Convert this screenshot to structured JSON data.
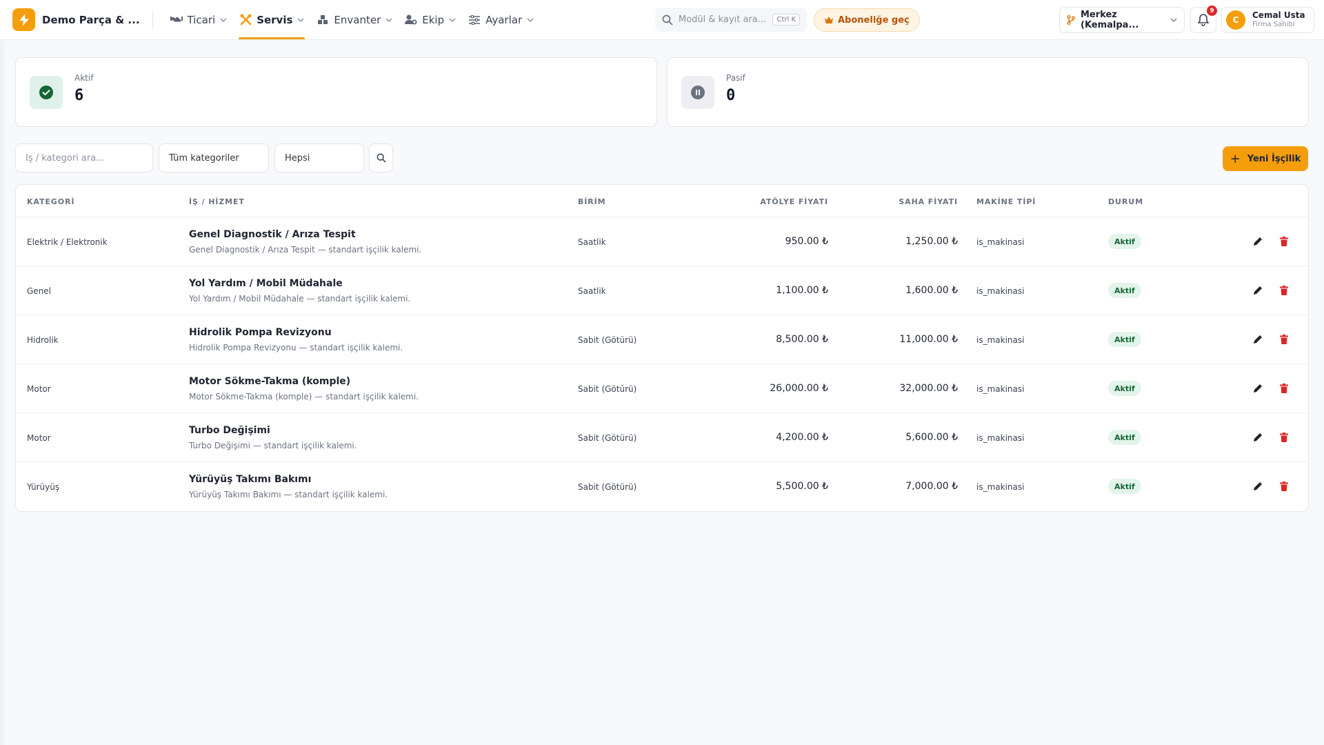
{
  "header": {
    "brand_name": "Demo Parça & ...",
    "nav": [
      {
        "label": "Ticari",
        "icon": "handshake-icon",
        "active": false
      },
      {
        "label": "Servis",
        "icon": "tools-icon",
        "active": true
      },
      {
        "label": "Envanter",
        "icon": "warehouse-icon",
        "active": false
      },
      {
        "label": "Ekip",
        "icon": "user-gear-icon",
        "active": false
      },
      {
        "label": "Ayarlar",
        "icon": "sliders-icon",
        "active": false
      }
    ],
    "search": {
      "placeholder": "Modül & kayıt ara...",
      "shortcut": "Ctrl K"
    },
    "subscribe_label": "Aboneliğe geç",
    "branch_label": "Merkez (Kemalpa...",
    "notification_count": "9",
    "user": {
      "initial": "C",
      "name": "Cemal Usta",
      "role": "Firma Sahibi"
    }
  },
  "stats": {
    "active": {
      "label": "Aktif",
      "value": "6"
    },
    "passive": {
      "label": "Pasif",
      "value": "0"
    }
  },
  "filters": {
    "search_placeholder": "İş / kategori ara...",
    "category_select": "Tüm kategoriler",
    "status_select": "Hepsi"
  },
  "new_button_label": "Yeni İşçilik",
  "table": {
    "columns": {
      "category": "KATEGORİ",
      "job": "İŞ / HİZMET",
      "unit": "BİRİM",
      "workshop_price": "ATÖLYE FİYATI",
      "field_price": "SAHA FİYATI",
      "machine_type": "MAKİNE TİPİ",
      "status": "DURUM"
    },
    "rows": [
      {
        "category": "Elektrik / Elektronik",
        "title": "Genel Diagnostik / Arıza Tespit",
        "desc": "Genel Diagnostik / Arıza Tespit — standart işçilik kalemi.",
        "unit": "Saatlik",
        "workshop_price": "950.00 ₺",
        "field_price": "1,250.00 ₺",
        "machine_type": "is_makinasi",
        "status": "Aktif"
      },
      {
        "category": "Genel",
        "title": "Yol Yardım / Mobil Müdahale",
        "desc": "Yol Yardım / Mobil Müdahale — standart işçilik kalemi.",
        "unit": "Saatlik",
        "workshop_price": "1,100.00 ₺",
        "field_price": "1,600.00 ₺",
        "machine_type": "is_makinasi",
        "status": "Aktif"
      },
      {
        "category": "Hidrolik",
        "title": "Hidrolik Pompa Revizyonu",
        "desc": "Hidrolik Pompa Revizyonu — standart işçilik kalemi.",
        "unit": "Sabit (Götürü)",
        "workshop_price": "8,500.00 ₺",
        "field_price": "11,000.00 ₺",
        "machine_type": "is_makinasi",
        "status": "Aktif"
      },
      {
        "category": "Motor",
        "title": "Motor Sökme-Takma (komple)",
        "desc": "Motor Sökme-Takma (komple) — standart işçilik kalemi.",
        "unit": "Sabit (Götürü)",
        "workshop_price": "26,000.00 ₺",
        "field_price": "32,000.00 ₺",
        "machine_type": "is_makinasi",
        "status": "Aktif"
      },
      {
        "category": "Motor",
        "title": "Turbo Değişimi",
        "desc": "Turbo Değişimi — standart işçilik kalemi.",
        "unit": "Sabit (Götürü)",
        "workshop_price": "4,200.00 ₺",
        "field_price": "5,600.00 ₺",
        "machine_type": "is_makinasi",
        "status": "Aktif"
      },
      {
        "category": "Yürüyüş",
        "title": "Yürüyüş Takımı Bakımı",
        "desc": "Yürüyüş Takımı Bakımı — standart işçilik kalemi.",
        "unit": "Sabit (Götürü)",
        "workshop_price": "5,500.00 ₺",
        "field_price": "7,000.00 ₺",
        "machine_type": "is_makinasi",
        "status": "Aktif"
      }
    ]
  },
  "colors": {
    "accent": "#f59e0b",
    "active_badge_bg": "#e3f4ea",
    "active_badge_text": "#166534",
    "delete": "#dc2626"
  }
}
